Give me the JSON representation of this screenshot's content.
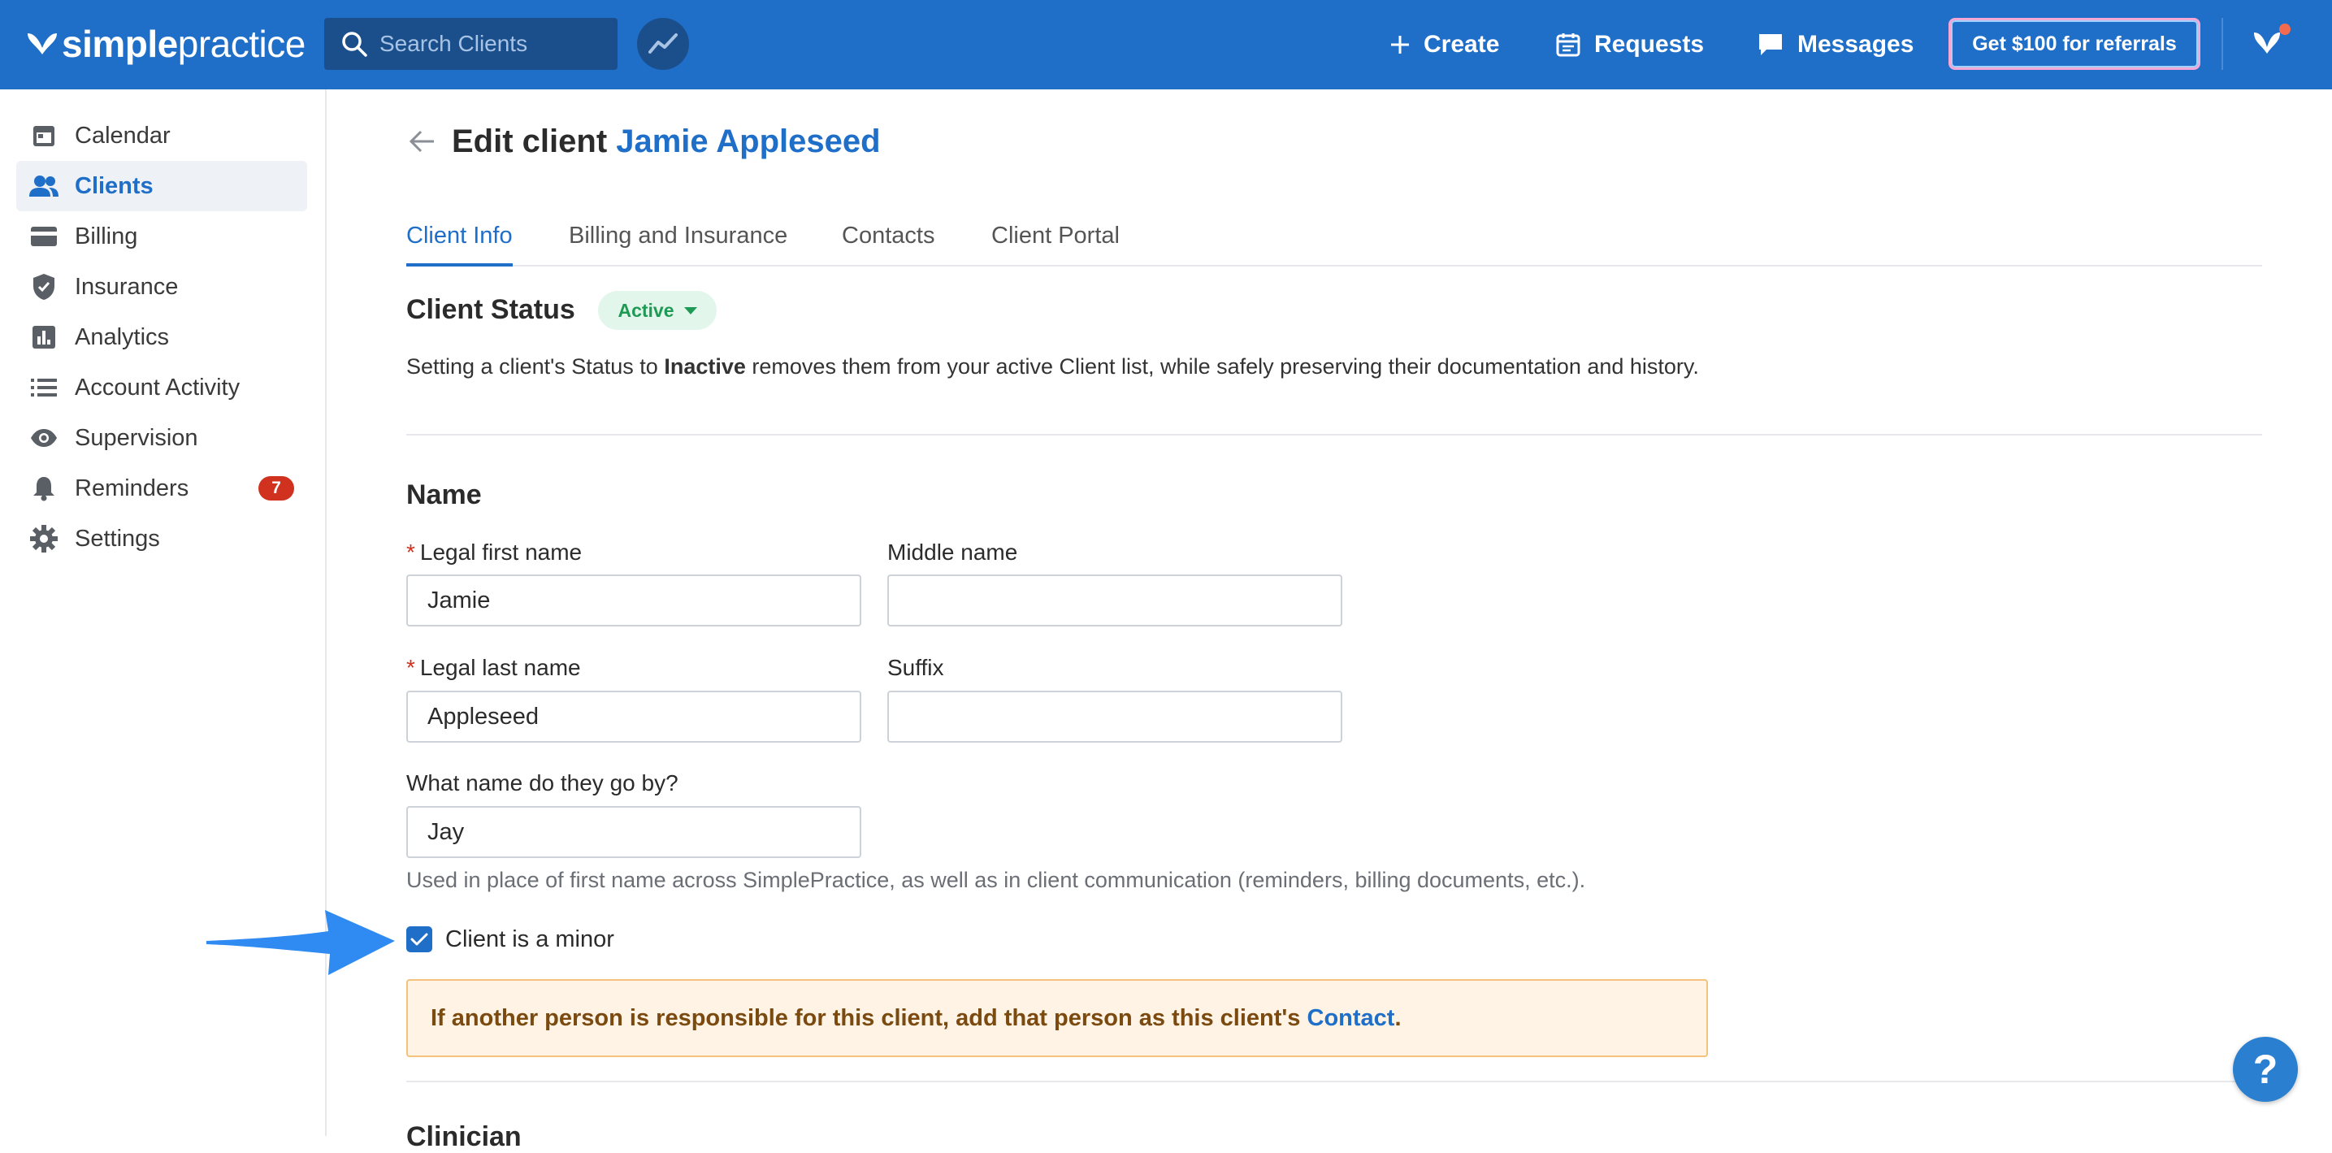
{
  "brand": {
    "bold": "simple",
    "light": "practice"
  },
  "search": {
    "placeholder": "Search Clients"
  },
  "topnav": {
    "create": "Create",
    "requests": "Requests",
    "messages": "Messages",
    "referral": "Get $100 for referrals"
  },
  "sidebar": {
    "items": [
      {
        "label": "Calendar",
        "icon": "calendar-icon"
      },
      {
        "label": "Clients",
        "icon": "clients-icon"
      },
      {
        "label": "Billing",
        "icon": "billing-icon"
      },
      {
        "label": "Insurance",
        "icon": "shield-icon"
      },
      {
        "label": "Analytics",
        "icon": "bar-chart-icon"
      },
      {
        "label": "Account Activity",
        "icon": "list-icon"
      },
      {
        "label": "Supervision",
        "icon": "eye-icon"
      },
      {
        "label": "Reminders",
        "icon": "bell-icon",
        "badge": "7"
      },
      {
        "label": "Settings",
        "icon": "gear-icon"
      }
    ],
    "active": "Clients"
  },
  "page": {
    "title_prefix": "Edit client ",
    "client_name": "Jamie Appleseed"
  },
  "tabs": [
    "Client Info",
    "Billing and Insurance",
    "Contacts",
    "Client Portal"
  ],
  "client_status": {
    "heading": "Client Status",
    "value": "Active",
    "desc_before": "Setting a client's Status to ",
    "desc_bold": "Inactive",
    "desc_after": " removes them from your active Client list, while safely preserving their documentation and history."
  },
  "name_section": {
    "heading": "Name",
    "first_label": "Legal first name",
    "first_value": "Jamie",
    "middle_label": "Middle name",
    "middle_value": "",
    "last_label": "Legal last name",
    "last_value": "Appleseed",
    "suffix_label": "Suffix",
    "suffix_value": "",
    "goes_by_label": "What name do they go by?",
    "goes_by_value": "Jay",
    "goes_by_help": "Used in place of first name across SimplePractice, as well as in client communication (reminders, billing documents, etc.)."
  },
  "minor": {
    "label": "Client is a minor",
    "checked": true,
    "alert_text": "If another person is responsible for this client, add that person as this client's ",
    "alert_link": "Contact",
    "alert_end": "."
  },
  "next_section": {
    "heading": "Clinician"
  },
  "help": {
    "label": "?"
  },
  "colors": {
    "brand": "#1f6ec8",
    "active_green": "#1f9a55",
    "badge_red": "#d1321f",
    "alert_bg": "#fef3e4"
  }
}
